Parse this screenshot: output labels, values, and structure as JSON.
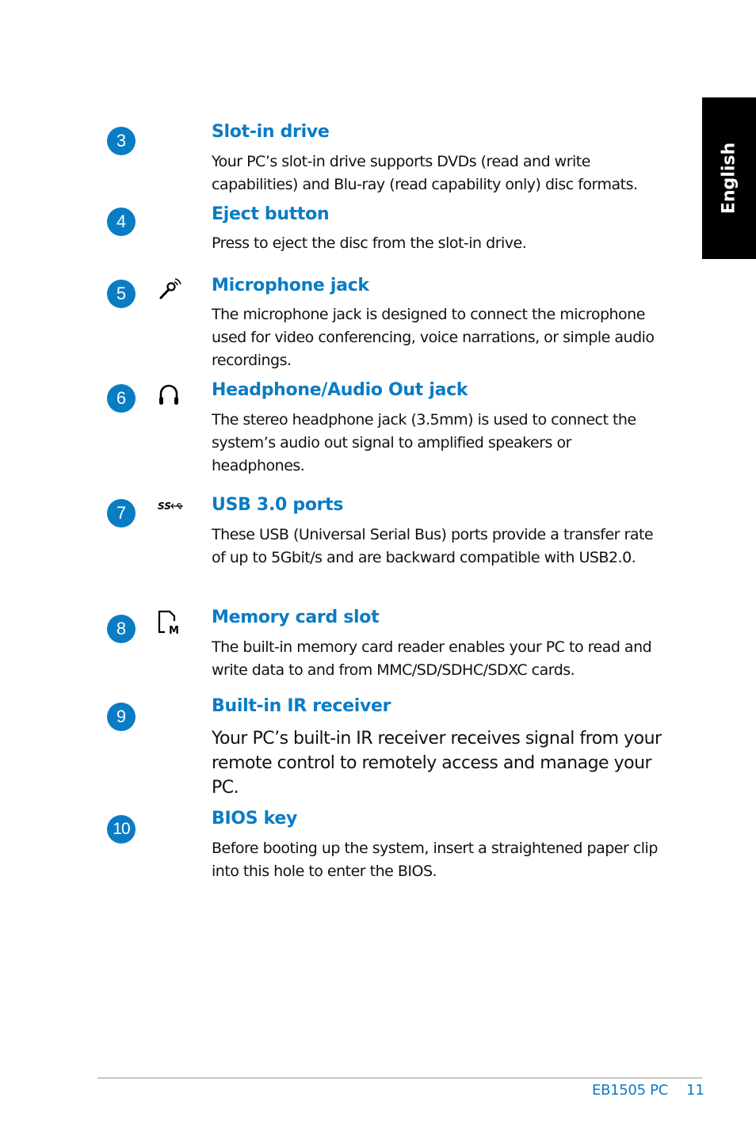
{
  "side_tab": {
    "label": "English"
  },
  "entries": [
    {
      "number": "3",
      "icon": "",
      "title": "Slot-in drive",
      "description": "Your PC’s slot-in drive supports DVDs (read and write capabilities) and Blu-ray (read capability only) disc formats."
    },
    {
      "number": "4",
      "icon": "",
      "title": "Eject button",
      "description": "Press to eject the disc from the slot-in drive."
    },
    {
      "number": "5",
      "icon": "microphone-icon",
      "title": "Microphone jack",
      "description": "The microphone jack is designed to connect the microphone used for video conferencing, voice narrations, or simple audio recordings."
    },
    {
      "number": "6",
      "icon": "headphone-icon",
      "title": "Headphone/Audio Out jack",
      "description": "The stereo headphone jack (3.5mm) is used to connect the system’s audio out signal to amplified speakers or headphones."
    },
    {
      "number": "7",
      "icon": "usb-superspeed-icon",
      "icon_text": "SS",
      "title": "USB 3.0 ports",
      "description": "These USB (Universal Serial Bus) ports provide a transfer rate of up to 5Gbit/s and are backward compatible with USB2.0."
    },
    {
      "number": "8",
      "icon": "memory-card-icon",
      "icon_text": "M",
      "title": "Memory card slot",
      "description": "The built-in memory card reader enables your PC to read and write data to and from MMC/SD/SDHC/SDXC cards."
    },
    {
      "number": "9",
      "icon": "",
      "title": "Built-in IR receiver",
      "description": "Your PC’s built-in IR receiver receives signal from your remote control to remotely access and manage your PC."
    },
    {
      "number": "10",
      "icon": "",
      "title": "BIOS key",
      "description": "Before booting up the system, insert a straightened paper clip into this hole to enter the BIOS."
    }
  ],
  "footer": {
    "model": "EB1505 PC",
    "page": "11"
  },
  "colors": {
    "accent": "#0a7cc4",
    "tab_bg": "#000000",
    "text": "#111111"
  }
}
